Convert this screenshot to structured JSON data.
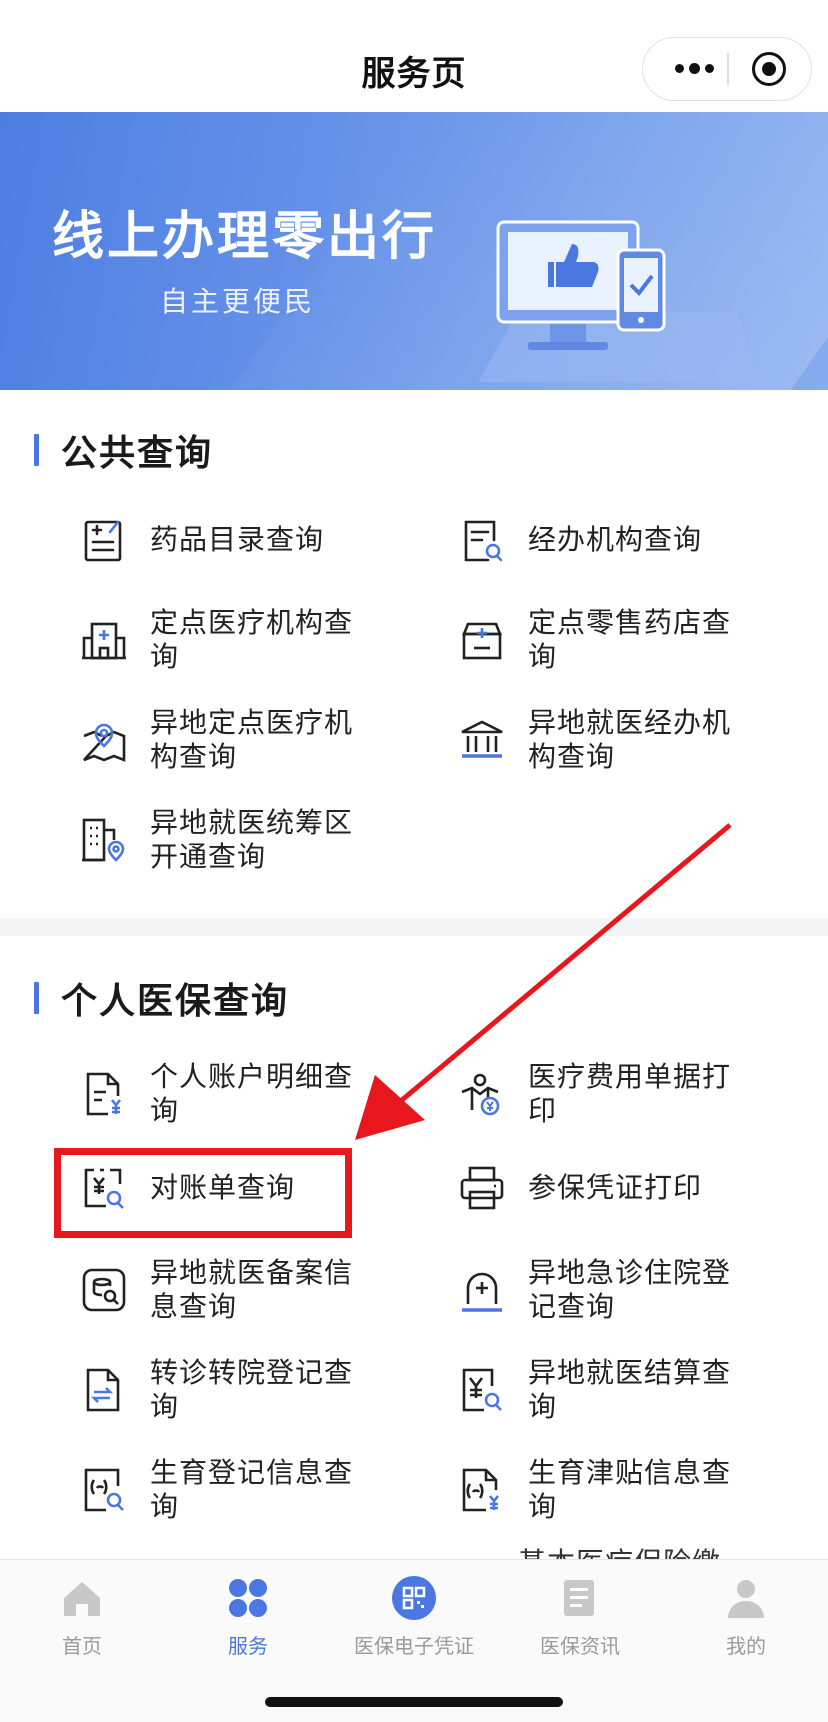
{
  "header": {
    "title": "服务页"
  },
  "banner": {
    "title": "线上办理零出行",
    "subtitle": "自主更便民"
  },
  "public_query": {
    "title": "公共查询",
    "items": [
      {
        "label": "药品目录查询",
        "icon": "drug-list-icon"
      },
      {
        "label": "经办机构查询",
        "icon": "agency-search-icon"
      },
      {
        "label": "定点医疗机构查询",
        "icon": "hospital-icon"
      },
      {
        "label": "定点零售药店查询",
        "icon": "pharmacy-icon"
      },
      {
        "label": "异地定点医疗机构查询",
        "icon": "map-location-icon"
      },
      {
        "label": "异地就医经办机构查询",
        "icon": "institution-icon"
      },
      {
        "label": "异地就医统筹区开通查询",
        "icon": "building-location-icon"
      }
    ]
  },
  "personal_query": {
    "title": "个人医保查询",
    "items": [
      {
        "label": "个人账户明细查询",
        "icon": "account-detail-icon"
      },
      {
        "label": "医疗费用单据打印",
        "icon": "expense-receipt-icon"
      },
      {
        "label": "对账单查询",
        "icon": "statement-search-icon"
      },
      {
        "label": "参保凭证打印",
        "icon": "printer-icon"
      },
      {
        "label": "异地就医备案信息查询",
        "icon": "record-info-icon"
      },
      {
        "label": "异地急诊住院登记查询",
        "icon": "emergency-icon"
      },
      {
        "label": "转诊转院登记查询",
        "icon": "transfer-icon"
      },
      {
        "label": "异地就医结算查询",
        "icon": "settlement-icon"
      },
      {
        "label": "生育登记信息查询",
        "icon": "maternity-registration-icon"
      },
      {
        "label": "生育津贴信息查询",
        "icon": "maternity-allowance-icon"
      }
    ],
    "peek_label": "基本医疗保险缴"
  },
  "tabs": [
    {
      "label": "首页",
      "icon": "home-icon"
    },
    {
      "label": "服务",
      "icon": "service-grid-icon"
    },
    {
      "label": "医保电子凭证",
      "icon": "qr-code-icon"
    },
    {
      "label": "医保资讯",
      "icon": "news-icon"
    },
    {
      "label": "我的",
      "icon": "user-icon"
    }
  ],
  "colors": {
    "accent": "#4a78e0",
    "highlight": "#e8171d",
    "banner": "#5b88e6"
  }
}
